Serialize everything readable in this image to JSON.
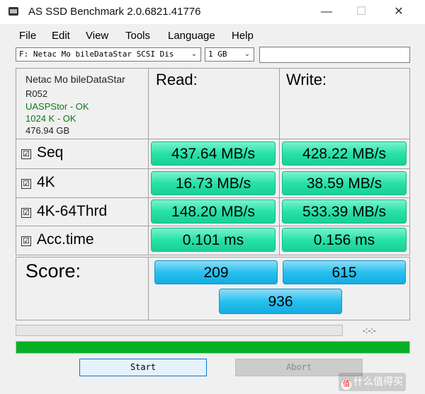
{
  "window": {
    "title": "AS SSD Benchmark 2.0.6821.41776",
    "minimize": "—",
    "maximize": "☐",
    "close": "✕"
  },
  "menu": [
    "File",
    "Edit",
    "View",
    "Tools",
    "Language",
    "Help"
  ],
  "drive_select": {
    "value": "F: Netac Mo bileDataStar SCSI Dis"
  },
  "size_select": {
    "value": "1 GB"
  },
  "drive_info": {
    "model": "Netac Mo bileDataStar",
    "firmware": "R052",
    "driver": "UASPStor - OK",
    "alignment": "1024 K - OK",
    "capacity": "476.94 GB"
  },
  "headers": {
    "read": "Read:",
    "write": "Write:"
  },
  "rows": [
    {
      "label": "Seq",
      "checked": true,
      "read": "437.64 MB/s",
      "write": "428.22 MB/s"
    },
    {
      "label": "4K",
      "checked": true,
      "read": "16.73 MB/s",
      "write": "38.59 MB/s"
    },
    {
      "label": "4K-64Thrd",
      "checked": true,
      "read": "148.20 MB/s",
      "write": "533.39 MB/s"
    },
    {
      "label": "Acc.time",
      "checked": true,
      "read": "0.101 ms",
      "write": "0.156 ms"
    }
  ],
  "score": {
    "label": "Score:",
    "read": "209",
    "write": "615",
    "total": "936"
  },
  "progress": {
    "elapsed": "-:-:-",
    "test_progress": 0,
    "overall_progress": 100
  },
  "buttons": {
    "start": "Start",
    "abort": "Abort"
  },
  "checkmark": "☑",
  "watermark": {
    "logo_glyph": "值",
    "text": "什么值得买"
  },
  "colors": {
    "result_green": "#27e2a6",
    "score_blue": "#27c1ee",
    "progress_green": "#06b025"
  }
}
